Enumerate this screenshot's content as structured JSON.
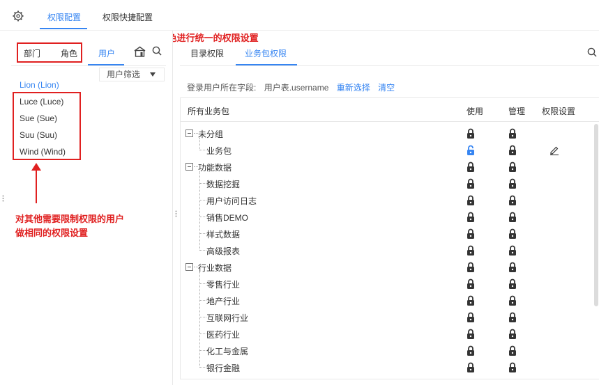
{
  "top_tabs": [
    "权限配置",
    "权限快捷配置"
  ],
  "annotations": {
    "top": "若有统一的部门和角色，也可用部门/角色进行统一的权限设置",
    "bottom_line1": "对其他需要限制权限的用户",
    "bottom_line2": "做相同的权限设置"
  },
  "left_tabs": [
    "部门",
    "角色",
    "用户"
  ],
  "filter_label": "用户筛选",
  "users": [
    "Lion (Lion)",
    "Luce (Luce)",
    "Sue (Sue)",
    "Suu (Suu)",
    "Wind (Wind)"
  ],
  "right_tabs": [
    "目录权限",
    "业务包权限"
  ],
  "login_field": {
    "label": "登录用户所在字段:",
    "value": "用户表.username",
    "reselect": "重新选择",
    "clear": "清空"
  },
  "table": {
    "headers": [
      "所有业务包",
      "使用",
      "管理",
      "权限设置"
    ],
    "rows": [
      {
        "name": "未分组",
        "level": 0
      },
      {
        "name": "业务包",
        "level": 1
      },
      {
        "name": "功能数据",
        "level": 0
      },
      {
        "name": "数据挖掘",
        "level": 1
      },
      {
        "name": "用户访问日志",
        "level": 1
      },
      {
        "name": "销售DEMO",
        "level": 1
      },
      {
        "name": "样式数据",
        "level": 1
      },
      {
        "name": "高级报表",
        "level": 1
      },
      {
        "name": "行业数据",
        "level": 0
      },
      {
        "name": "零售行业",
        "level": 1
      },
      {
        "name": "地产行业",
        "level": 1
      },
      {
        "name": "互联网行业",
        "level": 1
      },
      {
        "name": "医药行业",
        "level": 1
      },
      {
        "name": "化工与金属",
        "level": 1
      },
      {
        "name": "银行金融",
        "level": 1
      }
    ]
  },
  "colors": {
    "accent": "#3685f2",
    "annotation": "#e02020"
  }
}
